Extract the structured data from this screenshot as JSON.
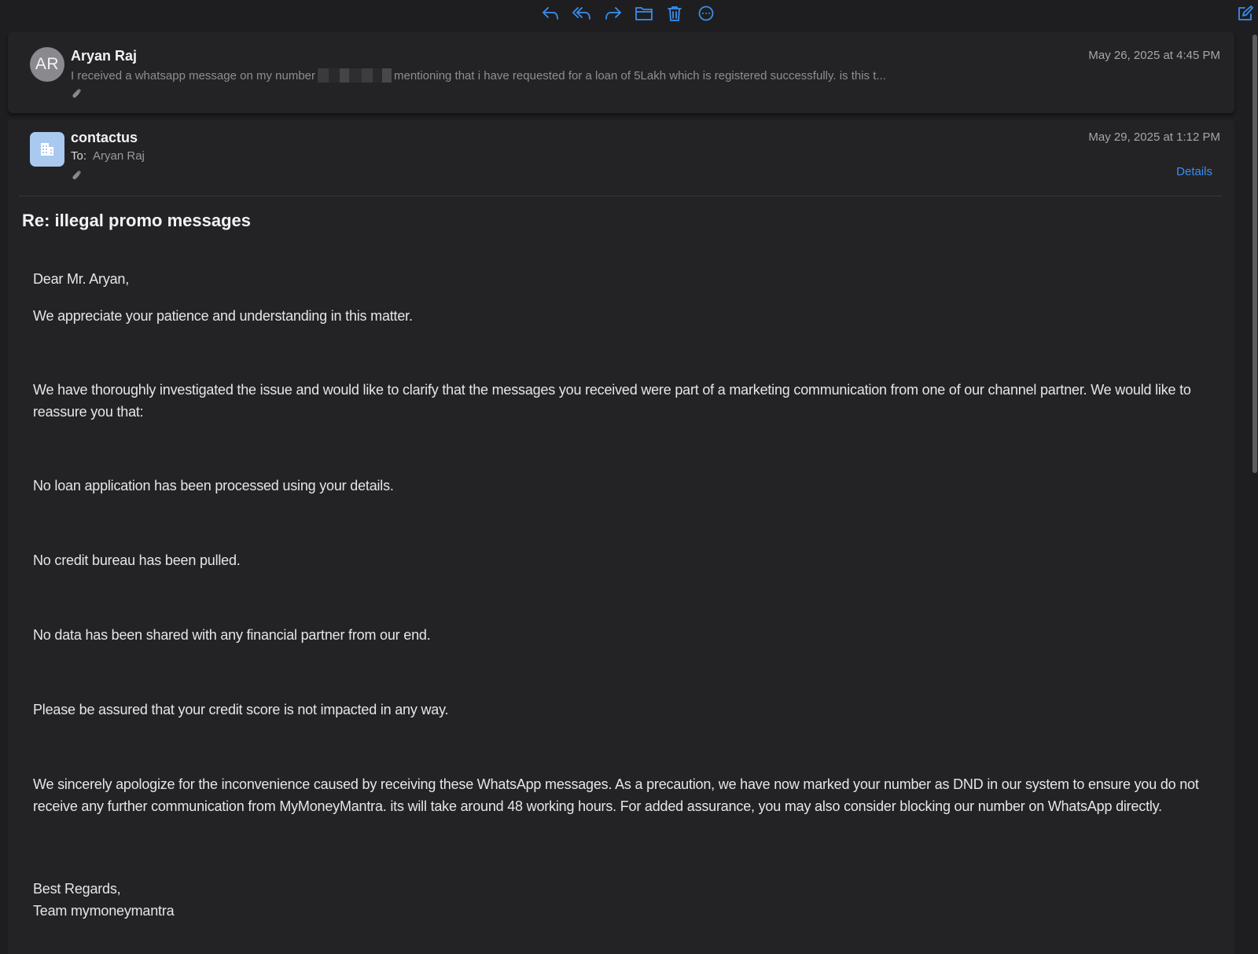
{
  "toolbar": {
    "icons": [
      "reply-icon",
      "reply-all-icon",
      "forward-icon",
      "move-folder-icon",
      "trash-icon",
      "more-icon",
      "compose-icon"
    ],
    "accent": "#3b8ef0"
  },
  "messages": [
    {
      "avatar_initials": "AR",
      "sender": "Aryan Raj",
      "date": "May 26, 2025 at 4:45 PM",
      "preview_before": "I received a whatsapp message on my number",
      "preview_after": "mentioning that i have requested for a loan of 5Lakh which is registered successfully. is this t..."
    },
    {
      "sender": "contactus",
      "date": "May 29, 2025 at 1:12 PM",
      "to_label": "To:",
      "to_name": "Aryan Raj",
      "details_label": "Details",
      "subject": "Re: illegal promo messages",
      "body": {
        "greeting": "Dear Mr. Aryan,",
        "p1": "We appreciate your patience and understanding in this matter.",
        "p2": "We have thoroughly investigated the issue and would like to clarify that the messages you received were part of a marketing communication from one of our channel partner. We would like to reassure you that:",
        "p3": "No loan application has been processed using your details.",
        "p4": "No credit bureau has been pulled.",
        "p5": "No data has been shared with any financial partner from our end.",
        "p6": "Please be assured that your credit score is not impacted in any way.",
        "p7": "We sincerely apologize for the inconvenience caused by receiving these WhatsApp messages. As a precaution, we have now marked your number as DND in our system to ensure you do not receive any further communication from MyMoneyMantra. its will take around 48 working hours.  For added assurance, you may also consider blocking our number on WhatsApp directly.",
        "closing": "Best Regards,",
        "signature": "Team mymoneymantra"
      }
    }
  ]
}
